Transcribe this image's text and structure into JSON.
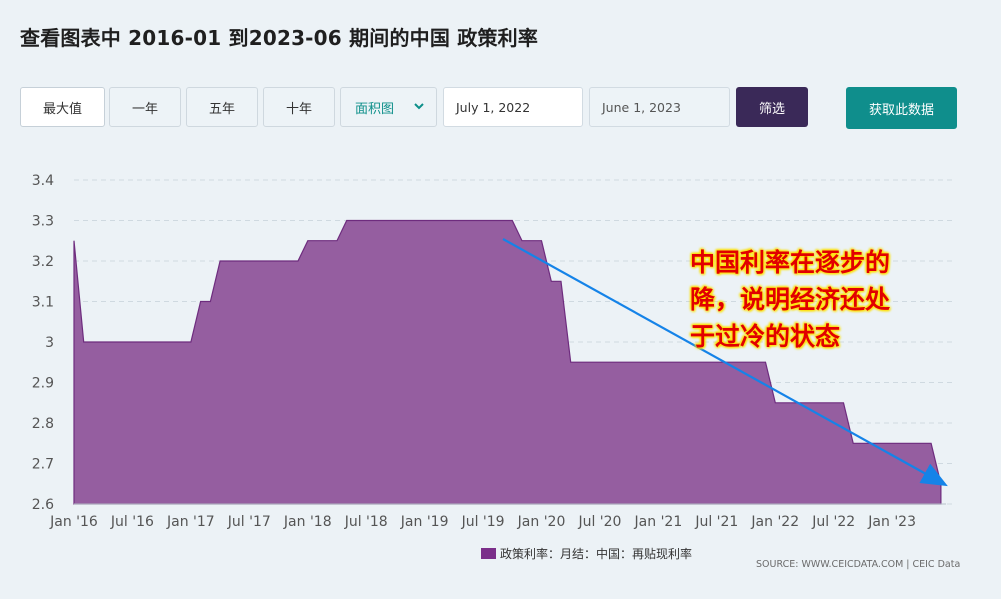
{
  "page": {
    "title": "查看图表中 2016-01 到2023-06 期间的中国 政策利率"
  },
  "toolbar": {
    "range_buttons": [
      "最大值",
      "一年",
      "五年",
      "十年"
    ],
    "chart_type_select": "面积图",
    "start_date": "July 1, 2022",
    "end_date": "June 1, 2023",
    "filter_label": "筛选",
    "get_data_label": "获取此数据"
  },
  "annotation": {
    "lines": [
      "中国利率在逐步的",
      "降，说明经济还处",
      "于过冷的状态"
    ],
    "color": "#e10000",
    "arrow_color": "#1583e8"
  },
  "legend": {
    "label": "政策利率：月结：中国：再贴现利率",
    "color": "#7b2f8a"
  },
  "source": "SOURCE: WWW.CEICDATA.COM | CEIC Data",
  "chart_data": {
    "type": "area",
    "title": "",
    "xlabel": "",
    "ylabel": "",
    "ylim": [
      2.6,
      3.4
    ],
    "yticks": [
      "3.4",
      "3.3",
      "3.2",
      "3.1",
      "3",
      "2.9",
      "2.8",
      "2.7",
      "2.6"
    ],
    "xticks": [
      "Jan '16",
      "Jul '16",
      "Jan '17",
      "Jul '17",
      "Jan '18",
      "Jul '18",
      "Jan '19",
      "Jul '19",
      "Jan '20",
      "Jul '20",
      "Jan '21",
      "Jul '21",
      "Jan '22",
      "Jul '22",
      "Jan '23"
    ],
    "grid": "horizontal dashed",
    "fill_color": "#955ea0",
    "line_color": "#6e2c7e",
    "series": [
      {
        "name": "政策利率：月结：中国：再贴现利率",
        "x": [
          "2016-01",
          "2016-02",
          "2016-03",
          "2016-04",
          "2016-05",
          "2016-06",
          "2016-07",
          "2016-08",
          "2016-09",
          "2016-10",
          "2016-11",
          "2016-12",
          "2017-01",
          "2017-02",
          "2017-03",
          "2017-04",
          "2017-05",
          "2017-06",
          "2017-07",
          "2017-08",
          "2017-09",
          "2017-10",
          "2017-11",
          "2017-12",
          "2018-01",
          "2018-02",
          "2018-03",
          "2018-04",
          "2018-05",
          "2018-06",
          "2018-07",
          "2018-08",
          "2018-09",
          "2018-10",
          "2018-11",
          "2018-12",
          "2019-01",
          "2019-02",
          "2019-03",
          "2019-04",
          "2019-05",
          "2019-06",
          "2019-07",
          "2019-08",
          "2019-09",
          "2019-10",
          "2019-11",
          "2019-12",
          "2020-01",
          "2020-02",
          "2020-03",
          "2020-04",
          "2020-05",
          "2020-06",
          "2020-07",
          "2020-08",
          "2020-09",
          "2020-10",
          "2020-11",
          "2020-12",
          "2021-01",
          "2021-02",
          "2021-03",
          "2021-04",
          "2021-05",
          "2021-06",
          "2021-07",
          "2021-08",
          "2021-09",
          "2021-10",
          "2021-11",
          "2021-12",
          "2022-01",
          "2022-02",
          "2022-03",
          "2022-04",
          "2022-05",
          "2022-06",
          "2022-07",
          "2022-08",
          "2022-09",
          "2022-10",
          "2022-11",
          "2022-12",
          "2023-01",
          "2023-02",
          "2023-03",
          "2023-04",
          "2023-05",
          "2023-06"
        ],
        "values": [
          3.25,
          3.0,
          3.0,
          3.0,
          3.0,
          3.0,
          3.0,
          3.0,
          3.0,
          3.0,
          3.0,
          3.0,
          3.0,
          3.1,
          3.1,
          3.2,
          3.2,
          3.2,
          3.2,
          3.2,
          3.2,
          3.2,
          3.2,
          3.2,
          3.25,
          3.25,
          3.25,
          3.25,
          3.3,
          3.3,
          3.3,
          3.3,
          3.3,
          3.3,
          3.3,
          3.3,
          3.3,
          3.3,
          3.3,
          3.3,
          3.3,
          3.3,
          3.3,
          3.3,
          3.3,
          3.3,
          3.25,
          3.25,
          3.25,
          3.15,
          3.15,
          2.95,
          2.95,
          2.95,
          2.95,
          2.95,
          2.95,
          2.95,
          2.95,
          2.95,
          2.95,
          2.95,
          2.95,
          2.95,
          2.95,
          2.95,
          2.95,
          2.95,
          2.95,
          2.95,
          2.95,
          2.95,
          2.85,
          2.85,
          2.85,
          2.85,
          2.85,
          2.85,
          2.85,
          2.85,
          2.75,
          2.75,
          2.75,
          2.75,
          2.75,
          2.75,
          2.75,
          2.75,
          2.75,
          2.65
        ]
      }
    ]
  }
}
